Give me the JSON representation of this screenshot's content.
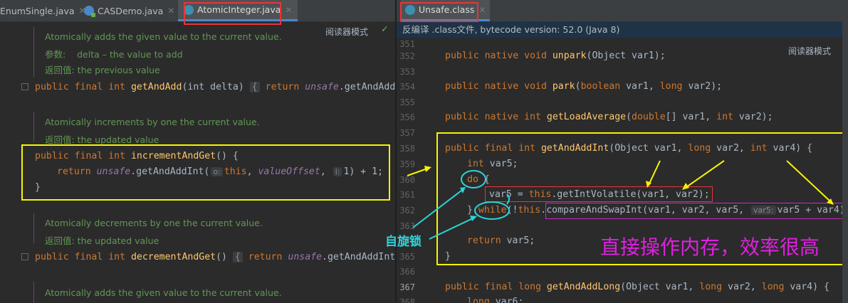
{
  "left_tabs": [
    {
      "label": "EnumSingle.java",
      "active": false
    },
    {
      "label": "CASDemo.java",
      "active": false
    },
    {
      "label": "AtomicInteger.java",
      "active": true
    }
  ],
  "right_tabs": [
    {
      "label": "Unsafe.class",
      "active": true
    }
  ],
  "left": {
    "reader_mode": "阅读器模式",
    "doc1": {
      "desc": "Atomically adds the given value to the current value.",
      "param_label": "参数:",
      "param_text": "delta – the value to add",
      "returns": "返回值: the previous value"
    },
    "code1": {
      "kw": "public final int ",
      "fn": "getAndAdd",
      "args": "(int delta) ",
      "fold": "{",
      "ret": " return ",
      "fld": "unsafe",
      "rest": ".getAndAddIn"
    },
    "doc2": {
      "desc": "Atomically increments by one the current value.",
      "returns": "返回值: the updated value"
    },
    "code2": {
      "l1_kw": "public final int ",
      "l1_fn": "incrementAndGet",
      "l1_rest": "() {",
      "l2_kw": "return ",
      "l2_fld": "unsafe",
      "l2_call": ".getAndAddInt(",
      "l2_hint1": "o:",
      "l2_this": "this",
      "l2_comma": ", ",
      "l2_fld2": "valueOffset",
      "l2_comma2": ", ",
      "l2_hint2": "i:",
      "l2_end": "1) + 1;",
      "l3": "}"
    },
    "doc3": {
      "desc": "Atomically decrements by one the current value.",
      "returns": "返回值: the updated value"
    },
    "code3": {
      "kw": "public final int ",
      "fn": "decrementAndGet",
      "args": "() ",
      "fold": "{",
      "ret": " return ",
      "fld": "unsafe",
      "rest": ".getAndAddInt("
    },
    "doc4": {
      "desc": "Atomically adds the given value to the current value."
    }
  },
  "right": {
    "banner": "反编译 .class文件, bytecode version: 52.0 (Java 8)",
    "reader_mode": "阅读器模式",
    "line_numbers": [
      "351",
      "352",
      "353",
      "354",
      "355",
      "356",
      "357",
      "358",
      "359",
      "360",
      "361",
      "362",
      "363",
      "364",
      "365",
      "366",
      "367",
      "368"
    ],
    "l352": {
      "kw": "public native void ",
      "fn": "unpark",
      "rest": "(Object var1);"
    },
    "l354": {
      "kw": "public native void ",
      "fn": "park",
      "a": "(",
      "kw2": "boolean",
      "b": " var1, ",
      "kw3": "long",
      "c": " var2);"
    },
    "l356": {
      "kw": "public native int ",
      "fn": "getLoadAverage",
      "a": "(",
      "kw2": "double",
      "b": "[] var1, ",
      "kw3": "int",
      "c": " var2);"
    },
    "l358": {
      "kw": "public final int ",
      "fn": "getAndAddInt",
      "a": "(Object var1, ",
      "kw2": "long",
      "b": " var2, ",
      "kw3": "int",
      "c": " var4) {"
    },
    "l359": {
      "kw": "int",
      "rest": " var5;"
    },
    "l360": {
      "kw": "do",
      "rest": " {"
    },
    "l361": {
      "a": "var5 = ",
      "kw": "this",
      "b": ".getIntVolatile(var1, var2);"
    },
    "l362": {
      "a": "} ",
      "kw": "while",
      "b": "(!",
      "kw2": "this",
      "c": ".compareAndSwapInt(var1, var2, var5, ",
      "hint": "var5:",
      "d": "var5 + var4)"
    },
    "l364": {
      "kw": "return",
      "rest": " var5;"
    },
    "l365": {
      "rest": "}"
    },
    "l367": {
      "kw": "public final long ",
      "fn": "getAndAddLong",
      "a": "(Object var1, ",
      "kw2": "long",
      "b": " var2, ",
      "kw3": "long",
      "c": " var4) {"
    },
    "l368": {
      "kw": "long",
      "rest": " var6;"
    }
  },
  "annotations": {
    "spin_lock": "自旋锁",
    "direct_memory": "直接操作内存，效率很高"
  },
  "colors": {
    "yellow_box": "#f5f500",
    "red_box": "#e8353b",
    "cyan_annotation": "#2fd3d8",
    "magenta_annotation": "#e020e0"
  }
}
